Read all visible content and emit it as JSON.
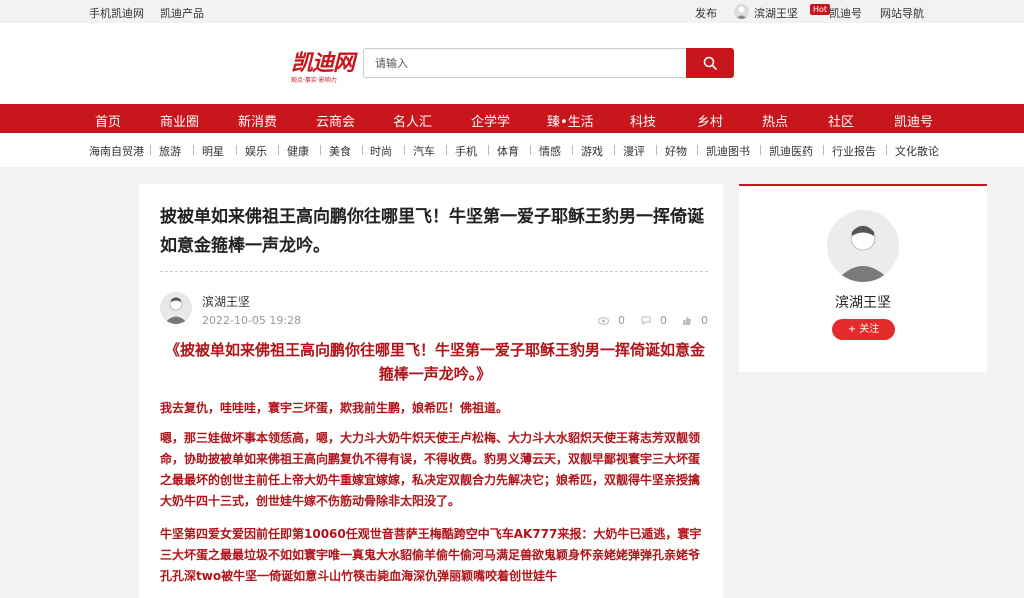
{
  "topbar": {
    "mobile": "手机凯迪网",
    "products": "凯迪产品",
    "publish": "发布",
    "user": "滨湖王坚",
    "hot_badge": "Hot",
    "kaidi_hao": "凯迪号",
    "site_nav": "网站导航"
  },
  "header": {
    "logo_text": "凯迪网",
    "logo_slogan": "观点·事实·影响力",
    "search_placeholder": "请输入"
  },
  "main_nav": [
    "首页",
    "商业圈",
    "新消费",
    "云商会",
    "名人汇",
    "企学学",
    "臻•生活",
    "科技",
    "乡村",
    "热点",
    "社区",
    "凯迪号"
  ],
  "sub_nav": [
    "海南自贸港",
    "旅游",
    "明星",
    "娱乐",
    "健康",
    "美食",
    "时尚",
    "汽车",
    "手机",
    "体育",
    "情感",
    "游戏",
    "漫评",
    "好物",
    "凯迪图书",
    "凯迪医药",
    "行业报告",
    "文化散论"
  ],
  "article": {
    "title": "披被单如来佛祖王高向鹏你往哪里飞！牛坚第一爱子耶稣王豹男一挥倚诞如意金箍棒一声龙吟。",
    "author": "滨湖王坚",
    "date": "2022-10-05 19:28",
    "views": "0",
    "comments": "0",
    "likes": "0",
    "body_title": "《披被单如来佛祖王高向鹏你往哪里飞！牛坚第一爱子耶稣王豹男一挥倚诞如意金箍棒一声龙吟。》",
    "paragraphs": [
      "我去复仇，哇哇哇，寰宇三坏蛋，欺我前生鹏，娘希匹！佛祖道。",
      "嗯，那三娃做坏事本领恁高，嗯，大力斗大奶牛炽天使王卢松梅、大力斗大水貂炽天使王蒋志芳双靓领命，协助披被单如来佛祖王高向鹏复仇不得有误，不得收费。豹男义薄云天，双靓早鄙视寰宇三大坏蛋之最最坏的创世主前任上帝大奶牛重嫁宜嫁嫁，私决定双靓合力先解决它；娘希匹，双靓得牛坚亲授擒大奶牛四十三式，创世娃牛嫁不伤筋动骨除非太阳没了。",
      "牛坚第四爱女爱因前任即第10060任观世音菩萨王梅酷跨空中飞车AK777来报：大奶牛已遁逃，寰宇三大坏蛋之最最垃圾不如如寰宇唯一真鬼大水貂偷羊偷牛偷河马满足兽欲鬼颖身怀亲姥姥弹弹孔亲姥爷孔孔深two被牛坚一倚诞如意斗山竹筷击毙血海深仇弹丽颖嘴咬着创世娃牛"
    ]
  },
  "sidebar": {
    "name": "滨湖王坚",
    "follow": "+ 关注"
  },
  "colors": {
    "brand_red": "#c8161d",
    "body_red": "#b0141a"
  }
}
